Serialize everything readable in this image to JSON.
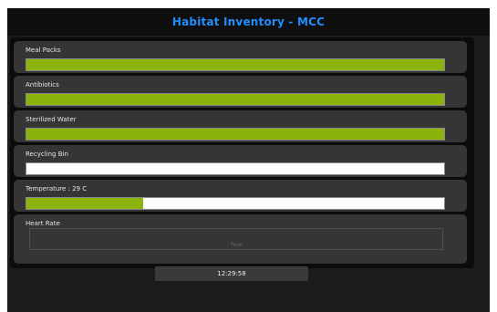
{
  "app": {
    "title": "Habitat Inventory - MCC"
  },
  "panels": [
    {
      "label": "Meal Packs",
      "level": 1.0
    },
    {
      "label": "Antibiotics",
      "level": 1.0
    },
    {
      "label": "Sterilized Water",
      "level": 1.0
    },
    {
      "label": "Recycling Bin",
      "level": 0.0
    },
    {
      "label": "Temperature : 29 C",
      "level": 0.28
    }
  ],
  "heart_rate": {
    "label": "Heart Rate",
    "x_axis_label": "Time"
  },
  "clock": {
    "time": "12:29:58"
  },
  "colors": {
    "accent_title": "#1f8fff",
    "bar_fill": "#8ab30b",
    "bar_track": "#ffffff",
    "panel_bg": "#353535",
    "window_bg": "#1c1c1c"
  }
}
